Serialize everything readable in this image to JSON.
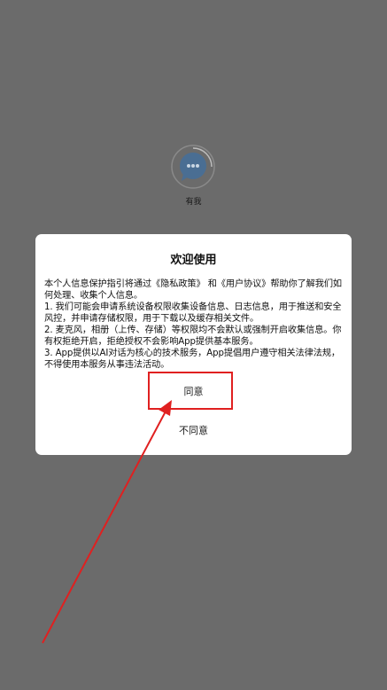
{
  "splash": {
    "app_name": "有我",
    "logo_icon": "chat-bubble-icon",
    "logo_color": "#4a6e93"
  },
  "dialog": {
    "title": "欢迎使用",
    "paragraphs": [
      "本个人信息保护指引将通过《隐私政策》 和《用户协议》帮助你了解我们如何处理、收集个人信息。",
      "1. 我们可能会申请系统设备权限收集设备信息、日志信息，用于推送和安全风控，并申请存储权限，用于下载以及缓存相关文件。",
      "2. 麦克风，相册（上传、存储）等权限均不会默认或强制开启收集信息。你有权拒绝开启，拒绝授权不会影响App提供基本服务。",
      "3. App提供以AI对话为核心的技术服务，App提倡用户遵守相关法律法规，不得使用本服务从事违法活动。"
    ],
    "agree_label": "同意",
    "disagree_label": "不同意"
  },
  "annotation": {
    "color": "#e02020"
  }
}
